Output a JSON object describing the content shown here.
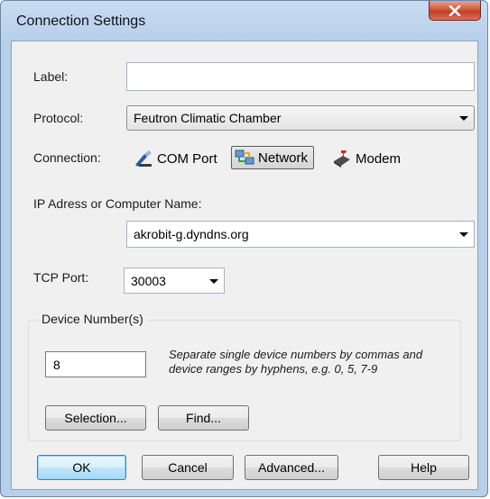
{
  "window": {
    "title": "Connection Settings"
  },
  "form": {
    "label": {
      "text": "Label:",
      "value": ""
    },
    "protocol": {
      "text": "Protocol:",
      "value": "Feutron Climatic Chamber"
    },
    "connection": {
      "text": "Connection:",
      "options": [
        {
          "label": "COM Port",
          "icon": "com-port-icon",
          "selected": false
        },
        {
          "label": "Network",
          "icon": "network-icon",
          "selected": true
        },
        {
          "label": "Modem",
          "icon": "modem-icon",
          "selected": false
        }
      ]
    },
    "ip": {
      "text": "IP Adress or Computer Name:",
      "value": "akrobit-g.dyndns.org"
    },
    "tcp_port": {
      "text": "TCP Port:",
      "value": "30003"
    },
    "device_numbers": {
      "title": "Device Number(s)",
      "value": "8",
      "hint": "Separate single device numbers by commas and device ranges by hyphens, e.g. 0, 5, 7-9",
      "selection_label": "Selection...",
      "find_label": "Find..."
    }
  },
  "buttons": {
    "ok": "OK",
    "cancel": "Cancel",
    "advanced": "Advanced...",
    "help": "Help"
  },
  "colors": {
    "title_bar": "#b7cfe9",
    "close_button": "#c13d25",
    "dialog_body": "#f0f0f0",
    "default_button_border": "#3c7fb1"
  }
}
